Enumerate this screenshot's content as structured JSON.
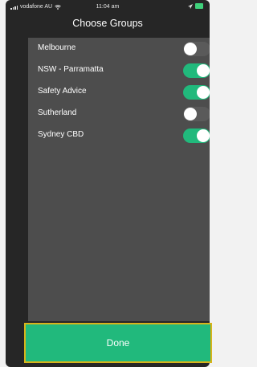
{
  "status_bar": {
    "carrier": "vodafone AU",
    "time": "11:04 am",
    "icons": [
      "signal-icon",
      "wifi-icon",
      "location-icon",
      "battery-icon"
    ]
  },
  "header": {
    "title": "Choose Groups"
  },
  "groups": [
    {
      "label": "Melbourne",
      "enabled": false
    },
    {
      "label": "NSW - Parramatta",
      "enabled": true
    },
    {
      "label": "Safety Advice",
      "enabled": true
    },
    {
      "label": "Sutherland",
      "enabled": false
    },
    {
      "label": "Sydney CBD",
      "enabled": true
    }
  ],
  "done_button": {
    "label": "Done"
  },
  "colors": {
    "accent": "#21b97c",
    "background": "#262626",
    "list_background": "#4d4d4d",
    "highlight_border": "#d8b41a"
  }
}
